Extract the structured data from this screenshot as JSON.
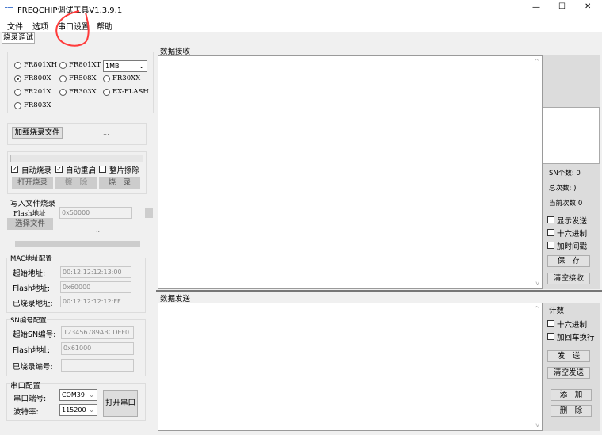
{
  "window": {
    "title": "FREQCHIP调试工具V1.3.9.1",
    "minimize": "—",
    "maximize": "☐",
    "close": "✕"
  },
  "menu": [
    "文件",
    "选项",
    "串口设置",
    "帮助"
  ],
  "tab": "烧录调试",
  "chips": {
    "options": [
      "FR801XH",
      "FR801XT",
      "FR800X",
      "FR508X",
      "FR30XX",
      "FR201X",
      "FR303X",
      "EX-FLASH",
      "FR803X"
    ],
    "selected": "FR800X",
    "flash_size": "1MB"
  },
  "load": {
    "button": "加载烧录文件",
    "path": "..."
  },
  "burn": {
    "progress": 0,
    "auto_burn": "自动烧录",
    "auto_restart": "自动重启",
    "chip_erase": "整片擦除",
    "auto_burn_checked": true,
    "auto_restart_checked": true,
    "chip_erase_checked": false,
    "open_burn": "打开烧录",
    "erase": "擦　除",
    "burn": "烧　录"
  },
  "write_file": {
    "title": "写入文件烧录",
    "flash_label": "Flash地址",
    "flash_value": "0x50000",
    "select_button": "选择文件",
    "path": "..."
  },
  "mac": {
    "title": "MAC地址配置",
    "start_label": "起始地址:",
    "start_value": "00:12:12:12:13:00",
    "flash_label": "Flash地址:",
    "flash_value": "0x60000",
    "burned_label": "已烧录地址:",
    "burned_value": "00:12:12:12:12:FF"
  },
  "sn": {
    "title": "SN编号配置",
    "start_label": "起始SN编号:",
    "start_value": "123456789ABCDEF0",
    "flash_label": "Flash地址:",
    "flash_value": "0x61000",
    "burned_label": "已烧录编号:",
    "burned_value": ""
  },
  "serial": {
    "title": "串口配置",
    "port_label": "串口端号:",
    "port_value": "COM39",
    "baud_label": "波特率:",
    "baud_value": "115200",
    "open_button": "打开串口"
  },
  "receive": {
    "title": "数据接收",
    "sn_count": "SN个数: 0",
    "total": "总次数: )",
    "current": "当前次数:0",
    "show_send": "显示发送",
    "hex": "十六进制",
    "timestamp": "加时间戳",
    "save": "保　存",
    "clear": "清空接收"
  },
  "send": {
    "title": "数据发送",
    "count": "计数",
    "hex": "十六进制",
    "crlf": "加回车换行",
    "send": "发　送",
    "clear": "清空发送",
    "add": "添　加",
    "delete": "删　除"
  },
  "colors": {
    "annotation": "#ff3b3b"
  }
}
